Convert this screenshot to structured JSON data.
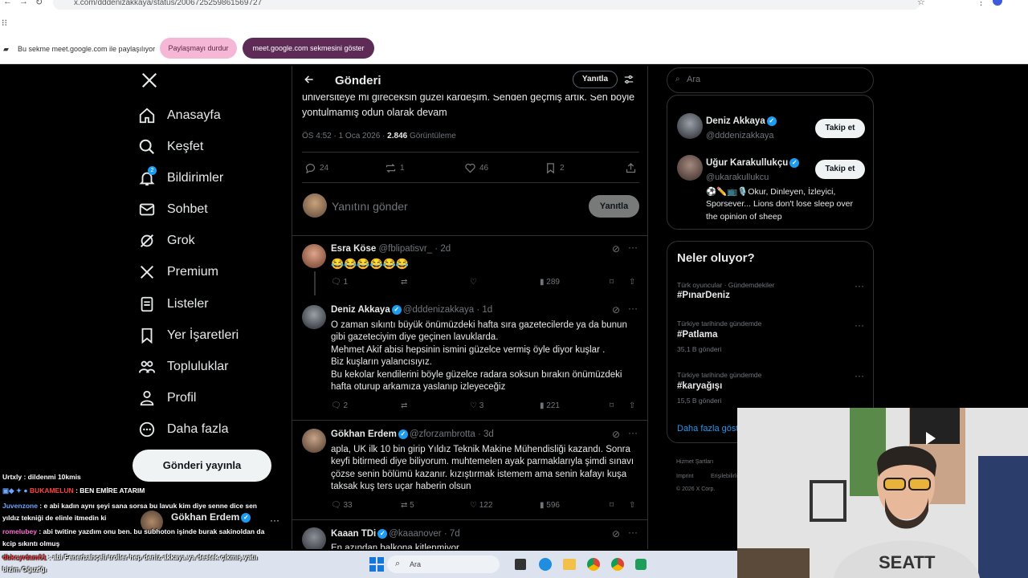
{
  "browser": {
    "url": "x.com/dddenizakkaya/status/2006725259861569727",
    "share_text": "Bu sekme meet.google.com ile paylaşılıyor",
    "stop_share_label": "Paylaşmayı durdur",
    "show_tab_label": "meet.google.com sekmesini göster"
  },
  "nav": {
    "items": [
      {
        "label": "Anasayfa",
        "icon": "home-icon"
      },
      {
        "label": "Keşfet",
        "icon": "search-icon"
      },
      {
        "label": "Bildirimler",
        "icon": "bell-icon",
        "badge": "2"
      },
      {
        "label": "Sohbet",
        "icon": "mail-icon"
      },
      {
        "label": "Grok",
        "icon": "grok-icon"
      },
      {
        "label": "Premium",
        "icon": "x-logo-icon"
      },
      {
        "label": "Listeler",
        "icon": "list-icon"
      },
      {
        "label": "Yer İşaretleri",
        "icon": "bookmark-icon"
      },
      {
        "label": "Topluluklar",
        "icon": "people-icon"
      },
      {
        "label": "Profil",
        "icon": "person-icon"
      },
      {
        "label": "Daha fazla",
        "icon": "more-circle-icon"
      }
    ],
    "post_button": "Gönderi yayınla",
    "account_name": "Gökhan Erdem"
  },
  "main": {
    "title": "Gönderi",
    "reply_chip": "Yanıtla",
    "post_text_1": "üniversiteye mi gireceksin güzel kardeşim. Senden geçmiş artık. Sen böyle",
    "post_text_2": "yontulmamış odun olarak devam",
    "meta_time": "ÖS 4:52 · 1 Oca 2026 · ",
    "meta_views": "2.846",
    "meta_views_label": " Görüntüleme",
    "stats": {
      "replies": "24",
      "reposts": "1",
      "likes": "46",
      "bookmarks": "2"
    },
    "compose_placeholder": "Yanıtını gönder",
    "compose_button": "Yanıtla"
  },
  "replies": [
    {
      "name": "Esra Köse",
      "handle": "@fblipatisvr_ · 2d",
      "verified": false,
      "text": [
        "😂😂😂😂😂😂"
      ],
      "stats": {
        "replies": "1",
        "reposts": "",
        "likes": "",
        "views": "289"
      }
    },
    {
      "name": "Deniz Akkaya",
      "handle": "@dddenizakkaya · 1d",
      "verified": true,
      "text": [
        "O zaman sıkıntı büyük önümüzdeki hafta sıra gazetecilerde ya da bunun",
        "gibi gazeteciyim diye geçinen lavuklarda.",
        "Mehmet Akif abisi hepsinin ismini güzelce vermiş öyle diyor kuşlar .",
        "Biz kuşların yalancısıyız.",
        "Bu kekolar kendilerini böyle güzelce radara soksun bırakın önümüzdeki",
        "hafta oturup arkamıza yaslanıp izleyeceğiz"
      ],
      "stats": {
        "replies": "2",
        "reposts": "",
        "likes": "3",
        "views": "221"
      }
    },
    {
      "name": "Gökhan Erdem",
      "handle": "@zforzambrotta · 3d",
      "verified": true,
      "text": [
        "apla, UK ilk 10 bin girip Yıldız Teknik Makine Mühendisliği kazandı. Sonra",
        "keyfi bitirmedi diye biliyorum. muhtemelen ayak parmaklarıyla şimdi sınavı",
        "çözse senin bölümü kazanır. kızıştırmak istemem ama senin kafayı kuşa",
        "taksak kuş ters uçar haberin olsun"
      ],
      "stats": {
        "replies": "33",
        "reposts": "5",
        "likes": "122",
        "views": "596"
      }
    },
    {
      "name": "Kaaan TDi",
      "handle": "@kaaanover · 7d",
      "verified": true,
      "text": [
        "En azından balkona kitlenmiyor"
      ],
      "stats": {}
    }
  ],
  "right": {
    "search_placeholder": "Ara",
    "suggestions": [
      {
        "name": "Deniz Akkaya",
        "handle": "@dddenizakkaya",
        "button": "Takip et"
      },
      {
        "name": "Uğur Karakullukçu",
        "handle": "@ukarakullukcu",
        "button": "Takip et",
        "bio_1": "⚽✏️📺🎙️Okur, Dinleyen, İzleyici,",
        "bio_2": "Sporsever... Lions don't lose sleep over",
        "bio_3": "the opinion of sheep"
      }
    ],
    "trends_title": "Neler oluyor?",
    "trends": [
      {
        "context": "Türk oyuncular · Gündemdekiler",
        "tag": "#PınarDeniz",
        "count": ""
      },
      {
        "context": "Türkiye tarihinde gündemde",
        "tag": "#Patlama",
        "count": "35,1 B gönderi"
      },
      {
        "context": "Türkiye tarihinde gündemde",
        "tag": "#karyağışı",
        "count": "15,5 B gönderi"
      }
    ],
    "show_more": "Daha fazla göster",
    "footer": [
      "Hizmet Şartları",
      "Imprint",
      "Erişilebilirlik",
      "© 2026 X Corp."
    ]
  },
  "chat": [
    {
      "user": "Urtxly",
      "color": "#ffffff",
      "text": " : dildenmi 10kmis"
    },
    {
      "user": "BUKAMELUN",
      "color": "#ff4040",
      "text": " : BEN EMİRE ATARIM"
    },
    {
      "user": "Juvenzone",
      "color": "#6aa7ff",
      "text": " : e abi kadın aynı şeyi sana sorsa bu lavuk kim diye senne dice sen"
    },
    {
      "user": "",
      "color": "#ffffff",
      "text": "yıldız tekniği de elinle itmedin ki"
    },
    {
      "user": "romelubey",
      "color": "#ff6bd6",
      "text": " : abi twitine yazdım onu ben. bu subhoton işinde burak sakinoldan da"
    },
    {
      "user": "",
      "color": "#ffffff",
      "text": "kcip sıkıntı olmuş"
    },
    {
      "user": "dbkcyrdam61",
      "color": "#ff4040",
      "text": " : abi Fenerbahçeli troller hep deniz akkaya ya destek çıkmış yatıı"
    },
    {
      "user": "",
      "color": "#ffffff",
      "text": "bizim Oğuz'ğı"
    }
  ],
  "taskbar": {
    "search": "Ara"
  },
  "colors": {
    "accent": "#1d9bf0",
    "share_pink": "#f6b7d7",
    "share_purple": "#5e2b56"
  }
}
